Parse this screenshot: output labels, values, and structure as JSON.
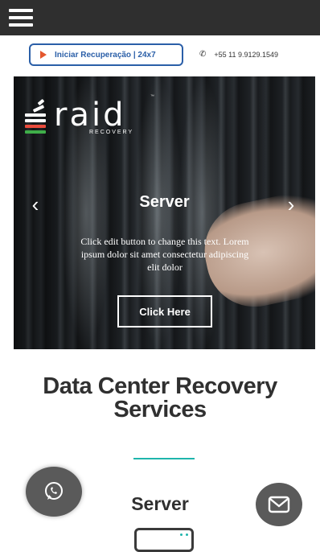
{
  "header": {
    "menu_icon": "hamburger-menu-icon",
    "background": "#2f2f2f"
  },
  "cta": {
    "recovery_label": "Iniciar Recuperação | 24x7",
    "recovery_icon": "play-icon",
    "accent_color": "#2b5fa8",
    "icon_color": "#e4572e",
    "phone": "+55 11 9.9129.1549",
    "phone_icon": "phone-icon"
  },
  "hero": {
    "logo_text": "raid",
    "logo_sub": "RECOVERY",
    "logo_tm": "™",
    "slide_title": "Server",
    "slide_text": "Click edit button to change this text. Lorem ipsum dolor sit amet consectetur adipiscing elit dolor",
    "button_label": "Click Here",
    "prev_arrow": "‹",
    "next_arrow": "›"
  },
  "section": {
    "title": "Data Center Recovery Services",
    "divider_color": "#1fb5ac",
    "service_title": "Server"
  },
  "floating": {
    "whatsapp_icon": "whatsapp-icon",
    "mail_icon": "mail-icon"
  }
}
